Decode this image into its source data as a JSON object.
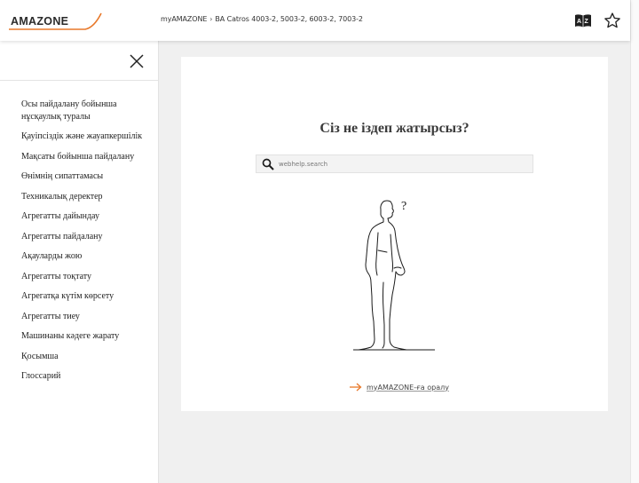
{
  "header": {
    "logo_text": "AMAZONE",
    "breadcrumb": [
      "myAMAZONE",
      "BA Catros 4003-2, 5003-2, 6003-2, 7003-2"
    ],
    "breadcrumb_separator": "›",
    "language_icon": "dictionary-az-icon",
    "favorite_icon": "star-outline-icon"
  },
  "sidebar": {
    "close_icon": "close-icon",
    "items": [
      {
        "label": "Осы пайдалану бойынша нұсқаулық туралы"
      },
      {
        "label": "Қауіпсіздік және жауапкершілік"
      },
      {
        "label": "Мақсаты бойынша пайдалану"
      },
      {
        "label": "Өнімнің сипаттамасы"
      },
      {
        "label": "Техникалық деректер"
      },
      {
        "label": "Агрегатты дайындау"
      },
      {
        "label": "Агрегатты пайдалану"
      },
      {
        "label": "Ақауларды жою"
      },
      {
        "label": "Агрегатты тоқтату"
      },
      {
        "label": "Агрегатқа күтім көрсету"
      },
      {
        "label": "Агрегатты тиеу"
      },
      {
        "label": "Машинаны кәдеге жарату"
      },
      {
        "label": "Қосымша"
      },
      {
        "label": "Глоссарий"
      }
    ]
  },
  "main": {
    "heading": "Сіз не іздеп жатырсыз?",
    "search": {
      "placeholder": "webhelp.search",
      "value": "",
      "icon": "search-icon"
    },
    "illustration": "thinking-man-question-mark",
    "link": {
      "label": "myAMAZONE-ға оралу",
      "icon": "arrow-right-icon"
    }
  },
  "colors": {
    "brand_orange": "#e8782a",
    "logo_text": "#2a2a2a",
    "page_bg": "#f0f0f0",
    "panel_bg": "#ffffff",
    "search_bg": "#f3f3f3"
  }
}
